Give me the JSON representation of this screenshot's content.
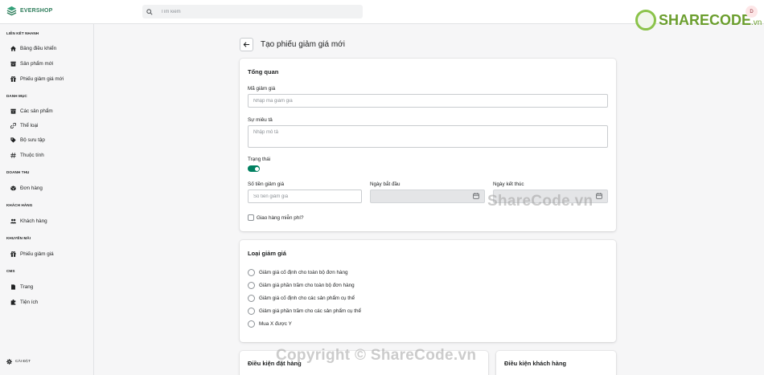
{
  "app": {
    "brand": "EVERSHOP"
  },
  "search": {
    "placeholder": "Tìm kiếm",
    "value": ""
  },
  "user": {
    "avatar_initial": "D"
  },
  "watermarks": {
    "top_brand_main": "SHARECODE",
    "top_brand_tld": ".vn",
    "middle": "ShareCode.vn",
    "bottom": "Copyright © ShareCode.vn"
  },
  "sidebar": {
    "sections": [
      {
        "title": "LIÊN KẾT NHANH",
        "items": [
          {
            "label": "Bảng điều khiển",
            "icon": "home-icon"
          },
          {
            "label": "Sản phẩm mới",
            "icon": "archive-icon"
          },
          {
            "label": "Phiếu giảm giá mới",
            "icon": "gift-icon"
          }
        ]
      },
      {
        "title": "DANH MỤC",
        "items": [
          {
            "label": "Các sản phẩm",
            "icon": "archive-icon"
          },
          {
            "label": "Thể loại",
            "icon": "link-icon"
          },
          {
            "label": "Bộ sưu tập",
            "icon": "tag-icon"
          },
          {
            "label": "Thuộc tính",
            "icon": "hash-icon"
          }
        ]
      },
      {
        "title": "DOANH THU",
        "items": [
          {
            "label": "Đơn hàng",
            "icon": "cube-icon"
          }
        ]
      },
      {
        "title": "KHÁCH HÀNG",
        "items": [
          {
            "label": "Khách hàng",
            "icon": "users-icon"
          }
        ]
      },
      {
        "title": "KHUYẾN MÃI",
        "items": [
          {
            "label": "Phiếu giảm giá",
            "icon": "gift-icon"
          }
        ]
      },
      {
        "title": "CMS",
        "items": [
          {
            "label": "Trang",
            "icon": "document-icon"
          },
          {
            "label": "Tiện ích",
            "icon": "puzzle-icon"
          }
        ]
      }
    ],
    "settings_label": "CÀI ĐẶT"
  },
  "page": {
    "title": "Tạo phiếu giảm giá mới"
  },
  "overview": {
    "title": "Tổng quan",
    "code_label": "Mã giảm giá",
    "code_placeholder": "Nhập mã giảm giá",
    "description_label": "Sự miêu tả",
    "description_placeholder": "Nhập mô tả",
    "status_label": "Trạng thái",
    "status_on": true,
    "amount_label": "Số tiền giảm giá",
    "amount_placeholder": "Số tiền giảm giá",
    "start_label": "Ngày bắt đầu",
    "end_label": "Ngày kết thúc",
    "free_shipping_label": "Giao hàng miễn phí?"
  },
  "discount_type": {
    "title": "Loại giảm giá",
    "options": [
      "Giảm giá cố định cho toàn bộ đơn hàng",
      "Giảm giá phần trăm cho toàn bộ đơn hàng",
      "Giảm giá cố định cho các sản phẩm cụ thể",
      "Giảm giá phần trăm cho các sản phẩm cụ thể",
      "Mua X được Y"
    ]
  },
  "order_conditions": {
    "title": "Điều kiện đặt hàng"
  },
  "customer_conditions": {
    "title": "Điều kiện khách hàng"
  },
  "colors": {
    "accent": "#008060",
    "brand": "#2e7d5b"
  }
}
